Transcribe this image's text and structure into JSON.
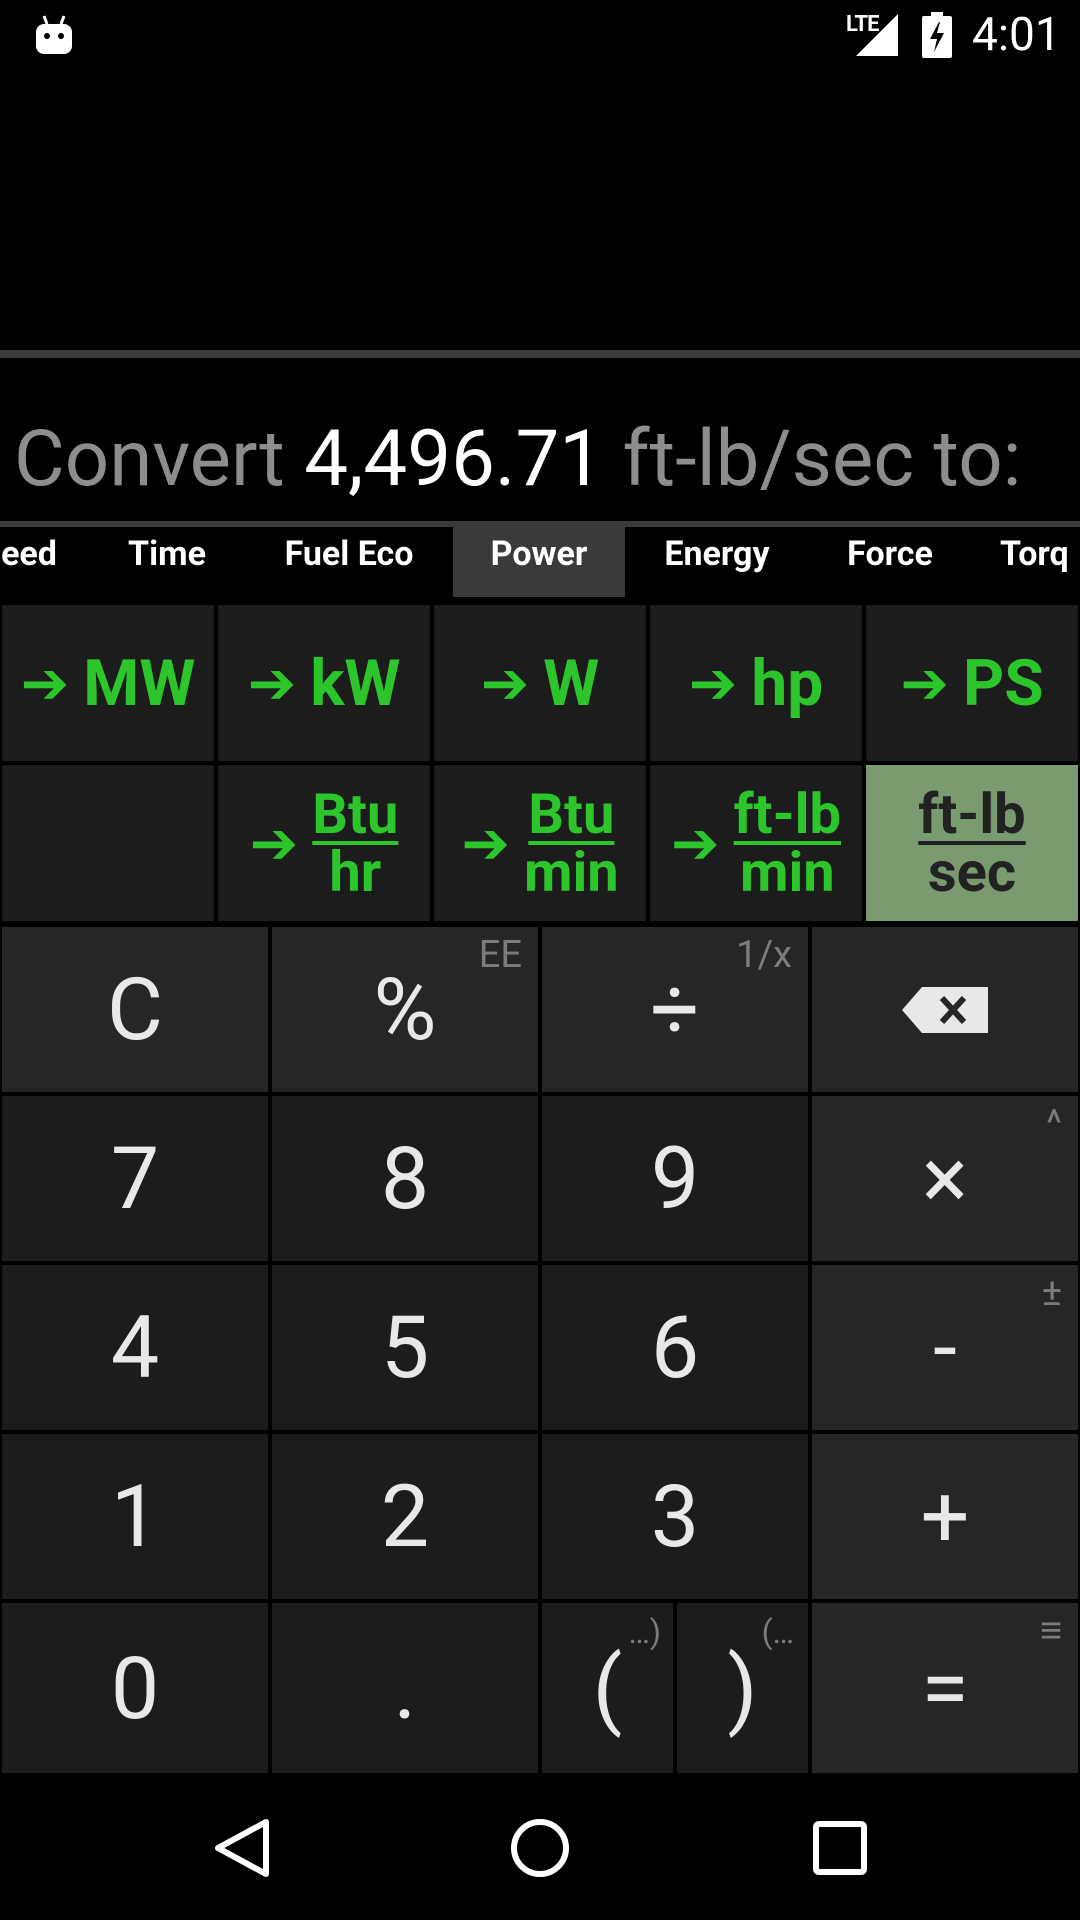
{
  "status_bar": {
    "network": "LTE",
    "time": "4:01"
  },
  "converter": {
    "prefix": "Convert",
    "value": "4,496.71",
    "suffix": "ft-lb/sec to:"
  },
  "tabs": [
    {
      "label": "eed",
      "selected": false
    },
    {
      "label": "Time",
      "selected": false
    },
    {
      "label": "Fuel Eco",
      "selected": false
    },
    {
      "label": "Power",
      "selected": true
    },
    {
      "label": "Energy",
      "selected": false
    },
    {
      "label": "Force",
      "selected": false
    },
    {
      "label": "Torq",
      "selected": false
    }
  ],
  "units_row1": [
    {
      "label": "MW"
    },
    {
      "label": "kW"
    },
    {
      "label": "W"
    },
    {
      "label": "hp"
    },
    {
      "label": "PS"
    }
  ],
  "units_row2": [
    {
      "num": "Btu",
      "den": "hr"
    },
    {
      "num": "Btu",
      "den": "min"
    },
    {
      "num": "ft-lb",
      "den": "min"
    },
    {
      "num": "ft-lb",
      "den": "sec",
      "active": true
    }
  ],
  "keys": {
    "clear": "C",
    "percent": "%",
    "percent_alt": "EE",
    "divide": "÷",
    "divide_alt": "1/x",
    "seven": "7",
    "eight": "8",
    "nine": "9",
    "multiply": "×",
    "multiply_alt": "^",
    "four": "4",
    "five": "5",
    "six": "6",
    "minus": "-",
    "minus_alt": "±",
    "one": "1",
    "two": "2",
    "three": "3",
    "plus": "+",
    "zero": "0",
    "dot": ".",
    "open_paren": "(",
    "open_paren_alt": "…)",
    "close_paren": ")",
    "close_paren_alt": "(…",
    "equals": "=",
    "equals_alt": "≡"
  },
  "colors": {
    "unit_green": "#2cc52c",
    "active_unit_bg": "#7a9a70",
    "key_bg": "#1c1c1c"
  }
}
